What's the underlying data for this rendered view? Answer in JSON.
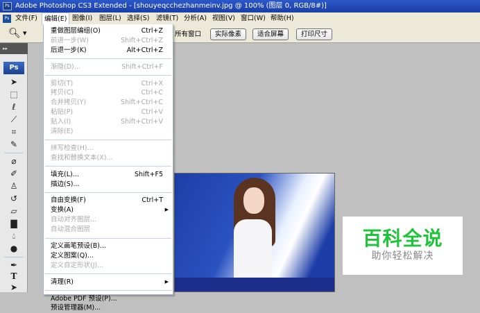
{
  "title": "Adobe Photoshop CS3 Extended - [shouyeqcchezhanmeinv.jpg @ 100% (图层 0, RGB/8#)]",
  "app_icon": "Ps",
  "menubar": [
    "文件(F)",
    "编辑(E)",
    "图像(I)",
    "图层(L)",
    "选择(S)",
    "滤镜(T)",
    "分析(A)",
    "视图(V)",
    "窗口(W)",
    "帮助(H)"
  ],
  "options": {
    "label": "所有窗口",
    "buttons": [
      "实际像素",
      "适合屏幕",
      "打印尺寸"
    ]
  },
  "tools": {
    "badge": "Ps",
    "strip": "▸▸"
  },
  "edit_menu": [
    {
      "label": "重做图层编组(O)",
      "shortcut": "Ctrl+Z",
      "enabled": true
    },
    {
      "label": "前进一步(W)",
      "shortcut": "Shift+Ctrl+Z",
      "enabled": false
    },
    {
      "label": "后退一步(K)",
      "shortcut": "Alt+Ctrl+Z",
      "enabled": true
    },
    {
      "sep": true
    },
    {
      "label": "渐隐(D)...",
      "shortcut": "Shift+Ctrl+F",
      "enabled": false
    },
    {
      "sep": true
    },
    {
      "label": "剪切(T)",
      "shortcut": "Ctrl+X",
      "enabled": false
    },
    {
      "label": "拷贝(C)",
      "shortcut": "Ctrl+C",
      "enabled": false
    },
    {
      "label": "合并拷贝(Y)",
      "shortcut": "Shift+Ctrl+C",
      "enabled": false
    },
    {
      "label": "粘贴(P)",
      "shortcut": "Ctrl+V",
      "enabled": false
    },
    {
      "label": "贴入(I)",
      "shortcut": "Shift+Ctrl+V",
      "enabled": false
    },
    {
      "label": "清除(E)",
      "shortcut": "",
      "enabled": false
    },
    {
      "sep": true
    },
    {
      "label": "拼写检查(H)...",
      "shortcut": "",
      "enabled": false
    },
    {
      "label": "查找和替换文本(X)...",
      "shortcut": "",
      "enabled": false
    },
    {
      "sep": true
    },
    {
      "label": "填充(L)...",
      "shortcut": "Shift+F5",
      "enabled": true
    },
    {
      "label": "描边(S)...",
      "shortcut": "",
      "enabled": true
    },
    {
      "sep": true
    },
    {
      "label": "自由变换(F)",
      "shortcut": "Ctrl+T",
      "enabled": true
    },
    {
      "label": "变换(A)",
      "shortcut": "",
      "enabled": true,
      "submenu": true
    },
    {
      "label": "自动对齐图层...",
      "shortcut": "",
      "enabled": false
    },
    {
      "label": "自动混合图层",
      "shortcut": "",
      "enabled": false
    },
    {
      "sep": true
    },
    {
      "label": "定义画笔预设(B)...",
      "shortcut": "",
      "enabled": true
    },
    {
      "label": "定义图案(Q)...",
      "shortcut": "",
      "enabled": true
    },
    {
      "label": "定义自定形状(J)...",
      "shortcut": "",
      "enabled": false
    },
    {
      "sep": true
    },
    {
      "label": "清理(R)",
      "shortcut": "",
      "enabled": true,
      "submenu": true
    },
    {
      "sep": true
    },
    {
      "label": "Adobe PDF 预设(P)...",
      "shortcut": "",
      "enabled": true
    },
    {
      "label": "预设管理器(M)...",
      "shortcut": "",
      "enabled": true
    }
  ],
  "watermark": {
    "title": "百科全说",
    "subtitle": "助你轻松解决"
  }
}
